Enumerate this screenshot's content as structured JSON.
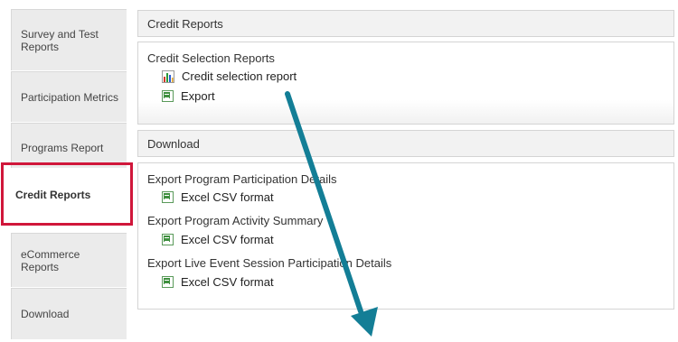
{
  "sidebar": {
    "items": [
      {
        "label": "Survey and Test\nReports"
      },
      {
        "label": "Participation Metrics"
      },
      {
        "label": "Programs Report"
      },
      {
        "label": "Credit Reports"
      },
      {
        "label": "eCommerce\nReports"
      },
      {
        "label": "Download"
      }
    ],
    "active_index": 3
  },
  "credit_reports": {
    "header": "Credit Reports",
    "section_title": "Credit Selection Reports",
    "links": [
      {
        "label": "Credit selection report",
        "icon": "bar-chart-icon"
      },
      {
        "label": "Export",
        "icon": "excel-icon"
      }
    ]
  },
  "download": {
    "header": "Download",
    "sections": [
      {
        "title": "Export Program Participation Details",
        "link": "Excel CSV format"
      },
      {
        "title": "Export Program Activity Summary",
        "link": "Excel CSV format"
      },
      {
        "title": "Export Live Event Session Participation Details",
        "link": "Excel CSV format"
      }
    ]
  },
  "colors": {
    "highlight": "#d0163a",
    "arrow": "#137e96",
    "excel_icon": "#3f8f3f"
  }
}
